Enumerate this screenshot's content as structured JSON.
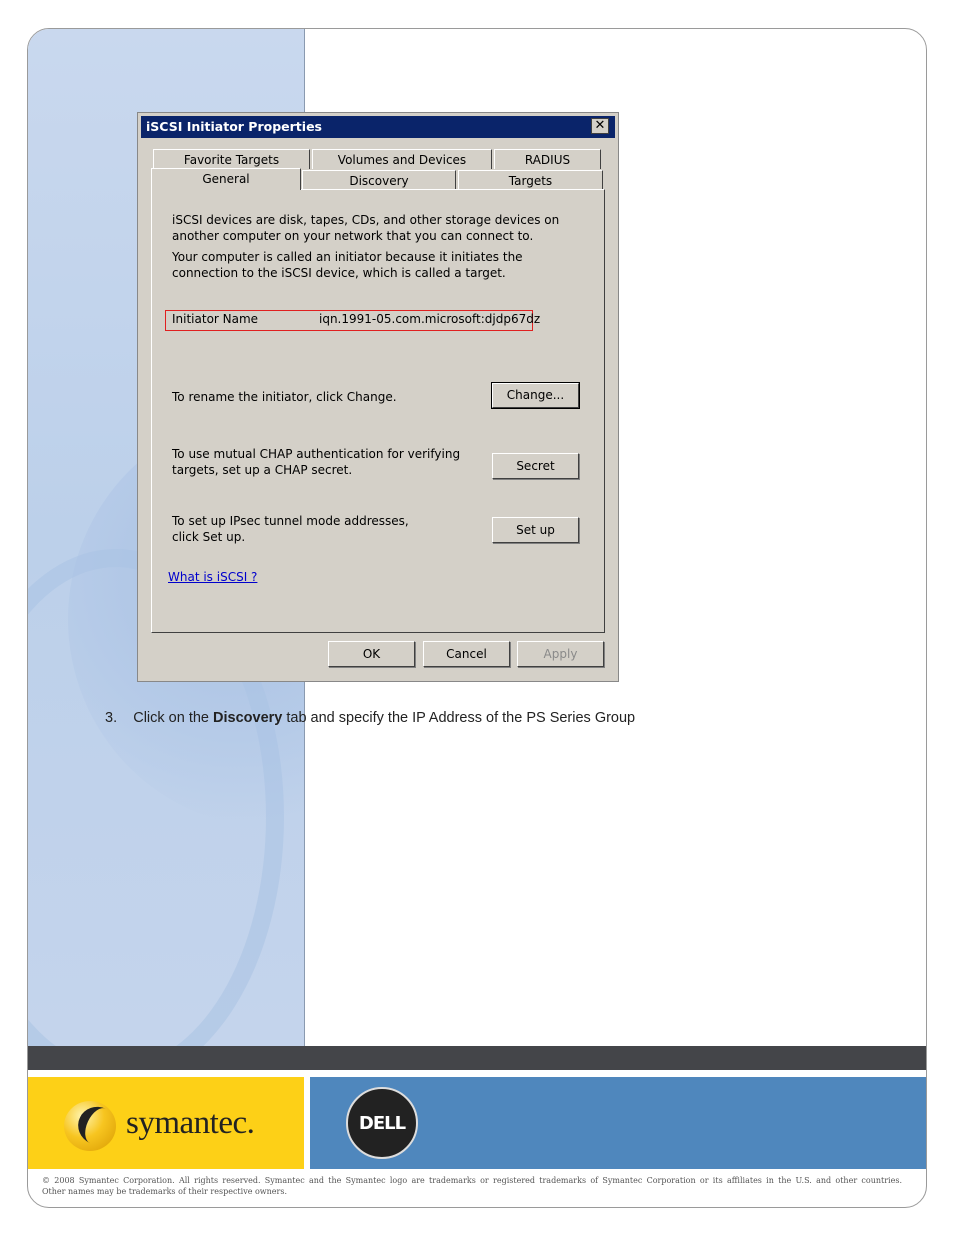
{
  "dialog": {
    "title": "iSCSI Initiator Properties",
    "close_glyph": "✕",
    "tabs_top": [
      "Favorite Targets",
      "Volumes and Devices",
      "RADIUS"
    ],
    "tabs_bottom": [
      "General",
      "Discovery",
      "Targets"
    ],
    "intro_1": "iSCSI devices are disk, tapes, CDs, and other storage devices on another computer on your network that you can connect to.",
    "intro_2": "Your computer is called an initiator because it initiates the connection to the iSCSI device, which is called a target.",
    "initiator_label": "Initiator Name",
    "initiator_value": "iqn.1991-05.com.microsoft:djdp67dz",
    "rename_text": "To rename the initiator, click Change.",
    "change_button": "Change...",
    "chap_text": "To use mutual CHAP authentication for verifying targets, set up a CHAP secret.",
    "secret_button": "Secret",
    "ipsec_text": "To set up IPsec tunnel mode addresses, click Set up.",
    "setup_button": "Set up",
    "help_link": "What is iSCSI ?",
    "ok_button": "OK",
    "cancel_button": "Cancel",
    "apply_button": "Apply"
  },
  "step": {
    "number": "3.",
    "pre": "Click on the ",
    "bold": "Discovery",
    "post": " tab and specify the IP Address of the PS Series Group"
  },
  "footer": {
    "symantec_logo_text": "symantec.",
    "dell_logo_text": "DELL",
    "copyright_line1": "© 2008 Symantec Corporation. All rights reserved. Symantec and the Symantec logo are trademarks or registered trademarks of Symantec Corporation or its affiliates in the U.S. and other countries.",
    "copyright_line2": "Other names may be trademarks of their respective owners."
  },
  "colors": {
    "symantec_yellow": "#fdd017",
    "dell_blue": "#4f87bd",
    "footer_dark": "#444549",
    "titlebar": "#0a246a",
    "highlight_red": "#e02020"
  }
}
